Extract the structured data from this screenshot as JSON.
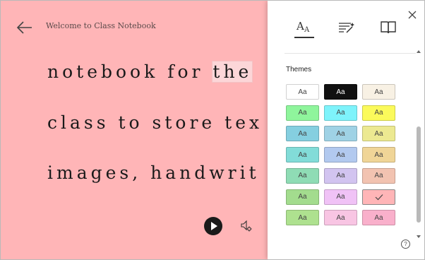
{
  "reader": {
    "title": "Welcome to Class Notebook",
    "lines": [
      {
        "before": "notebook for ",
        "highlight": "the",
        "after": ""
      },
      {
        "before": "class to store tex",
        "highlight": "",
        "after": ""
      },
      {
        "before": "images, handwrit",
        "highlight": "",
        "after": ""
      }
    ],
    "colors": {
      "background": "#ffb5b7",
      "highlight": "#fcd6d8"
    }
  },
  "panel": {
    "tabs": [
      {
        "name": "text-preferences",
        "icon": "text-size-icon",
        "active": true
      },
      {
        "name": "grammar-options",
        "icon": "grammar-wand-icon",
        "active": false
      },
      {
        "name": "reading-preferences",
        "icon": "book-icon",
        "active": false
      }
    ],
    "themes_label": "Themes",
    "help_label": "?",
    "swatch_label": "Aa",
    "swatches": [
      {
        "color": "#ffffff",
        "label": "Aa",
        "selected": false
      },
      {
        "color": "#111111",
        "label": "Aa",
        "selected": false,
        "dark": true
      },
      {
        "color": "#f8f1e4",
        "label": "Aa",
        "selected": false
      },
      {
        "color": "#8ff59c",
        "label": "Aa",
        "selected": false
      },
      {
        "color": "#7ef3fb",
        "label": "Aa",
        "selected": false
      },
      {
        "color": "#fbfa5b",
        "label": "Aa",
        "selected": false
      },
      {
        "color": "#85cfe0",
        "label": "Aa",
        "selected": false
      },
      {
        "color": "#9fd2e5",
        "label": "Aa",
        "selected": false
      },
      {
        "color": "#ece991",
        "label": "Aa",
        "selected": false
      },
      {
        "color": "#82dcd8",
        "label": "Aa",
        "selected": false
      },
      {
        "color": "#b2c9ef",
        "label": "Aa",
        "selected": false
      },
      {
        "color": "#f0d597",
        "label": "Aa",
        "selected": false
      },
      {
        "color": "#8fdcb5",
        "label": "Aa",
        "selected": false
      },
      {
        "color": "#d2c4f0",
        "label": "Aa",
        "selected": false
      },
      {
        "color": "#f2c3b1",
        "label": "Aa",
        "selected": false
      },
      {
        "color": "#a3dc8e",
        "label": "Aa",
        "selected": false
      },
      {
        "color": "#f0c2f6",
        "label": "Aa",
        "selected": false
      },
      {
        "color": "#ffb5b7",
        "label": "",
        "selected": true
      },
      {
        "color": "#aee18f",
        "label": "Aa",
        "selected": false
      },
      {
        "color": "#f8c5e3",
        "label": "Aa",
        "selected": false
      },
      {
        "color": "#f9b0cb",
        "label": "Aa",
        "selected": false
      }
    ]
  }
}
